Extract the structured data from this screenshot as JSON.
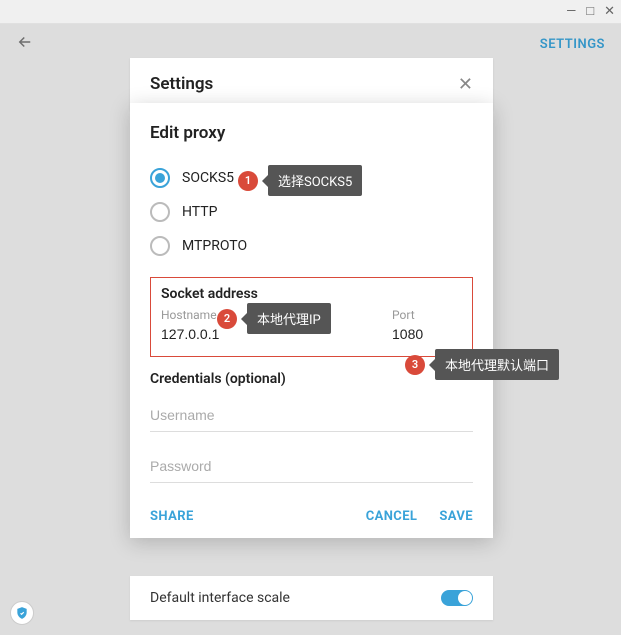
{
  "window": {
    "minimize": "—",
    "maximize": "□",
    "close": "✕"
  },
  "header": {
    "settings_link": "SETTINGS",
    "settings_title": "Settings"
  },
  "modal": {
    "title": "Edit proxy",
    "radios": {
      "socks5": "SOCKS5",
      "http": "HTTP",
      "mtproto": "MTPROTO"
    },
    "socket": {
      "title": "Socket address",
      "hostname_label": "Hostname",
      "hostname_value": "127.0.0.1",
      "port_label": "Port",
      "port_value": "1080"
    },
    "credentials": {
      "title": "Credentials (optional)",
      "username_placeholder": "Username",
      "password_placeholder": "Password"
    },
    "actions": {
      "share": "SHARE",
      "cancel": "CANCEL",
      "save": "SAVE"
    }
  },
  "callouts": {
    "c1": {
      "num": "1",
      "tip": "选择SOCKS5"
    },
    "c2": {
      "num": "2",
      "tip": "本地代理IP"
    },
    "c3": {
      "num": "3",
      "tip": "本地代理默认端口"
    }
  },
  "bottom": {
    "scale_label": "Default interface scale"
  }
}
